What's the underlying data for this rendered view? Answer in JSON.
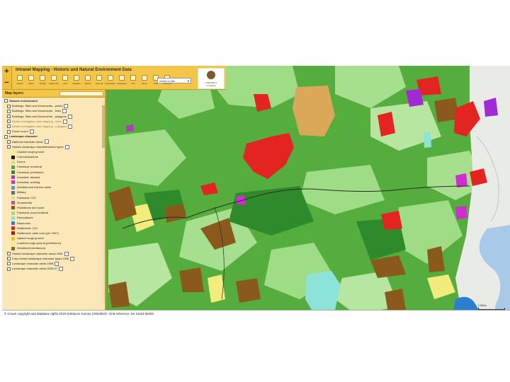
{
  "app": {
    "title": "Intranet Mapping - Historic and Natural Environment Data",
    "zoom_in": "+",
    "zoom_out": "−"
  },
  "toolbar": {
    "tools": [
      "search",
      "select",
      "identify",
      "select tool",
      "print",
      "measure",
      "sketch",
      "clear all",
      "bookmarks",
      "streetview",
      "info",
      "about",
      "help",
      "overview"
    ],
    "select_site_value": "Select a site"
  },
  "logo": {
    "line1": "CORNWALL",
    "line2": "COUNCIL"
  },
  "layers_panel": {
    "title": "Map layers",
    "items": [
      {
        "label": "Historic environment",
        "kind": "group"
      },
      {
        "label": "Buildings, Sites and Monuments - points",
        "kind": "layer"
      },
      {
        "label": "Buildings, Sites and Monuments - lines",
        "kind": "layer"
      },
      {
        "label": "Buildings, Sites and Monuments - polygons",
        "kind": "layer"
      },
      {
        "label": "Aerial investigation and mapping - lines",
        "kind": "layer-dim"
      },
      {
        "label": "Aerial investigation and mapping - polygons",
        "kind": "layer-dim"
      },
      {
        "label": "Event record",
        "kind": "layer"
      },
      {
        "label": "Landscape character",
        "kind": "group"
      },
      {
        "label": "National character areas",
        "kind": "layer"
      },
      {
        "label": "Historic landscape characterisation types",
        "kind": "layer"
      },
      {
        "label": "Coastal rough ground",
        "kind": "legend",
        "color": "#f4f07a"
      },
      {
        "label": "Communications",
        "kind": "legend",
        "color": "#1a1a1a"
      },
      {
        "label": "Dunes",
        "kind": "legend",
        "color": "#e8d78a"
      },
      {
        "label": "Farmland: medieval",
        "kind": "legend",
        "color": "#4fa93a"
      },
      {
        "label": "Farmland: prehistoric",
        "kind": "legend",
        "color": "#2f8a2b"
      },
      {
        "label": "Industrial: disused",
        "kind": "legend",
        "color": "#b03ab8"
      },
      {
        "label": "Industrial: working",
        "kind": "legend",
        "color": "#d02cd2"
      },
      {
        "label": "Intertidal and inshore water",
        "kind": "legend",
        "color": "#4a9fd6"
      },
      {
        "label": "Military",
        "kind": "legend",
        "color": "#6b6b6b"
      },
      {
        "label": "Farmland: C20",
        "kind": "legend",
        "color": "#c9e8a8"
      },
      {
        "label": "Ornamental",
        "kind": "legend",
        "color": "#d14d9a"
      },
      {
        "label": "Plantations and scrub",
        "kind": "legend",
        "color": "#8a5a1c"
      },
      {
        "label": "Farmland: post-medieval",
        "kind": "legend",
        "color": "#9fdc86"
      },
      {
        "label": "Recreational",
        "kind": "legend",
        "color": "#8ee3d8"
      },
      {
        "label": "Reservoirs",
        "kind": "legend",
        "color": "#2a7fd0"
      },
      {
        "label": "Settlement: C20",
        "kind": "legend",
        "color": "#e32420"
      },
      {
        "label": "Settlement: older core (pre 1907)",
        "kind": "legend",
        "color": "#b01a1a"
      },
      {
        "label": "Upland rough ground",
        "kind": "legend",
        "color": "#e6c13a"
      },
      {
        "label": "Lowland rough ground (prehistoric)",
        "kind": "legend",
        "color": "#f2ec7c"
      },
      {
        "label": "Woodland (deciduous)",
        "kind": "legend",
        "color": "#8a6a2a"
      },
      {
        "label": "Historic landscape character areas 1994",
        "kind": "layer"
      },
      {
        "label": "Fully revised landscape character types 1996",
        "kind": "layer"
      },
      {
        "label": "Landscape character areas 1996",
        "kind": "layer"
      },
      {
        "label": "Landscape character areas 2005-07",
        "kind": "layer"
      }
    ]
  },
  "footer": {
    "copyright": "© Crown copyright and database rights 2019 Ordnance Survey 100049047. Grid reference: SX 31163 58403"
  },
  "scale": {
    "label": "0        500m"
  },
  "colors": {
    "farmland_medieval": "#4fa93a",
    "farmland_prehistoric": "#2f8a2b",
    "farmland_postmedieval": "#9fdc86",
    "settlement_c20": "#e32420",
    "plantations": "#8a5a1c",
    "industrial": "#b03ab8",
    "recreational": "#8ee3d8",
    "rough_ground": "#f2ec7c",
    "panel_bg": "#fbe7b8",
    "header_bg": "#f3c64a"
  }
}
